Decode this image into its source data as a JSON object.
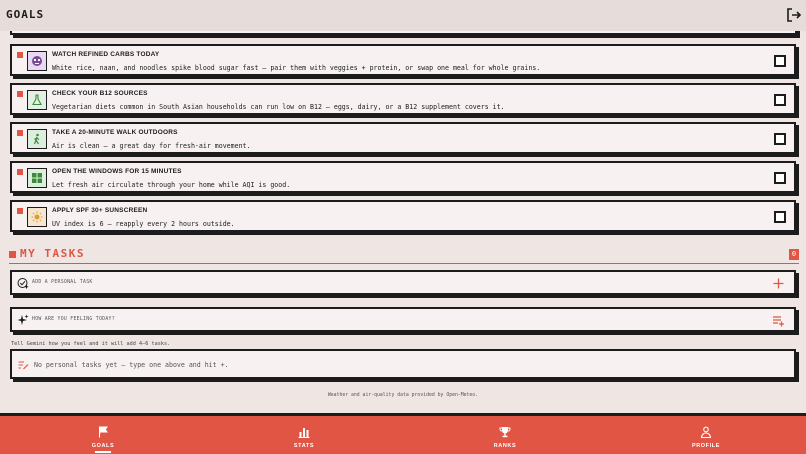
{
  "header": {
    "title": "GOALS",
    "logout_icon": "logout-icon"
  },
  "colors": {
    "accent": "#e05544",
    "background": "#efe6e3",
    "card": "#f7f2f1",
    "ink": "#1c1c1c"
  },
  "goals": [
    {
      "title": "WATCH REFINED CARBS TODAY",
      "desc": "White rice, naan, and noodles spike blood sugar fast — pair them with veggies + protein, or swap one meal for whole grains.",
      "icon": "alien-face-icon",
      "icon_bg": "#e9d8f0"
    },
    {
      "title": "CHECK YOUR B12 SOURCES",
      "desc": "Vegetarian diets common in South Asian households can run low on B12 — eggs, dairy, or a B12 supplement covers it.",
      "icon": "flask-icon",
      "icon_bg": "#e2efe2"
    },
    {
      "title": "TAKE A 20-MINUTE WALK OUTDOORS",
      "desc": "Air is clean — a great day for fresh-air movement.",
      "icon": "walking-person-icon",
      "icon_bg": "#dcefdc"
    },
    {
      "title": "OPEN THE WINDOWS FOR 15 MINUTES",
      "desc": "Let fresh air circulate through your home while AQI is good.",
      "icon": "window-icon",
      "icon_bg": "#dcefdc"
    },
    {
      "title": "APPLY SPF 30+ SUNSCREEN",
      "desc": "UV index is 6 — reapply every 2 hours outside.",
      "icon": "sun-icon",
      "icon_bg": "#f6e6cf"
    }
  ],
  "tasks": {
    "title": "MY TASKS",
    "count": "0",
    "add_placeholder": "ADD A PERSONAL TASK",
    "feeling_placeholder": "HOW ARE YOU FEELING TODAY?",
    "hint": "Tell Gemini how you feel and it will add 4–6 tasks.",
    "empty_text": "No personal tasks yet — type one above and hit +."
  },
  "footer_note": "Weather and air-quality data provided by Open-Meteo.",
  "nav": [
    {
      "label": "GOALS",
      "icon": "flag-icon",
      "active": true
    },
    {
      "label": "STATS",
      "icon": "bar-chart-icon",
      "active": false
    },
    {
      "label": "RANKS",
      "icon": "trophy-icon",
      "active": false
    },
    {
      "label": "PROFILE",
      "icon": "person-icon",
      "active": false
    }
  ]
}
